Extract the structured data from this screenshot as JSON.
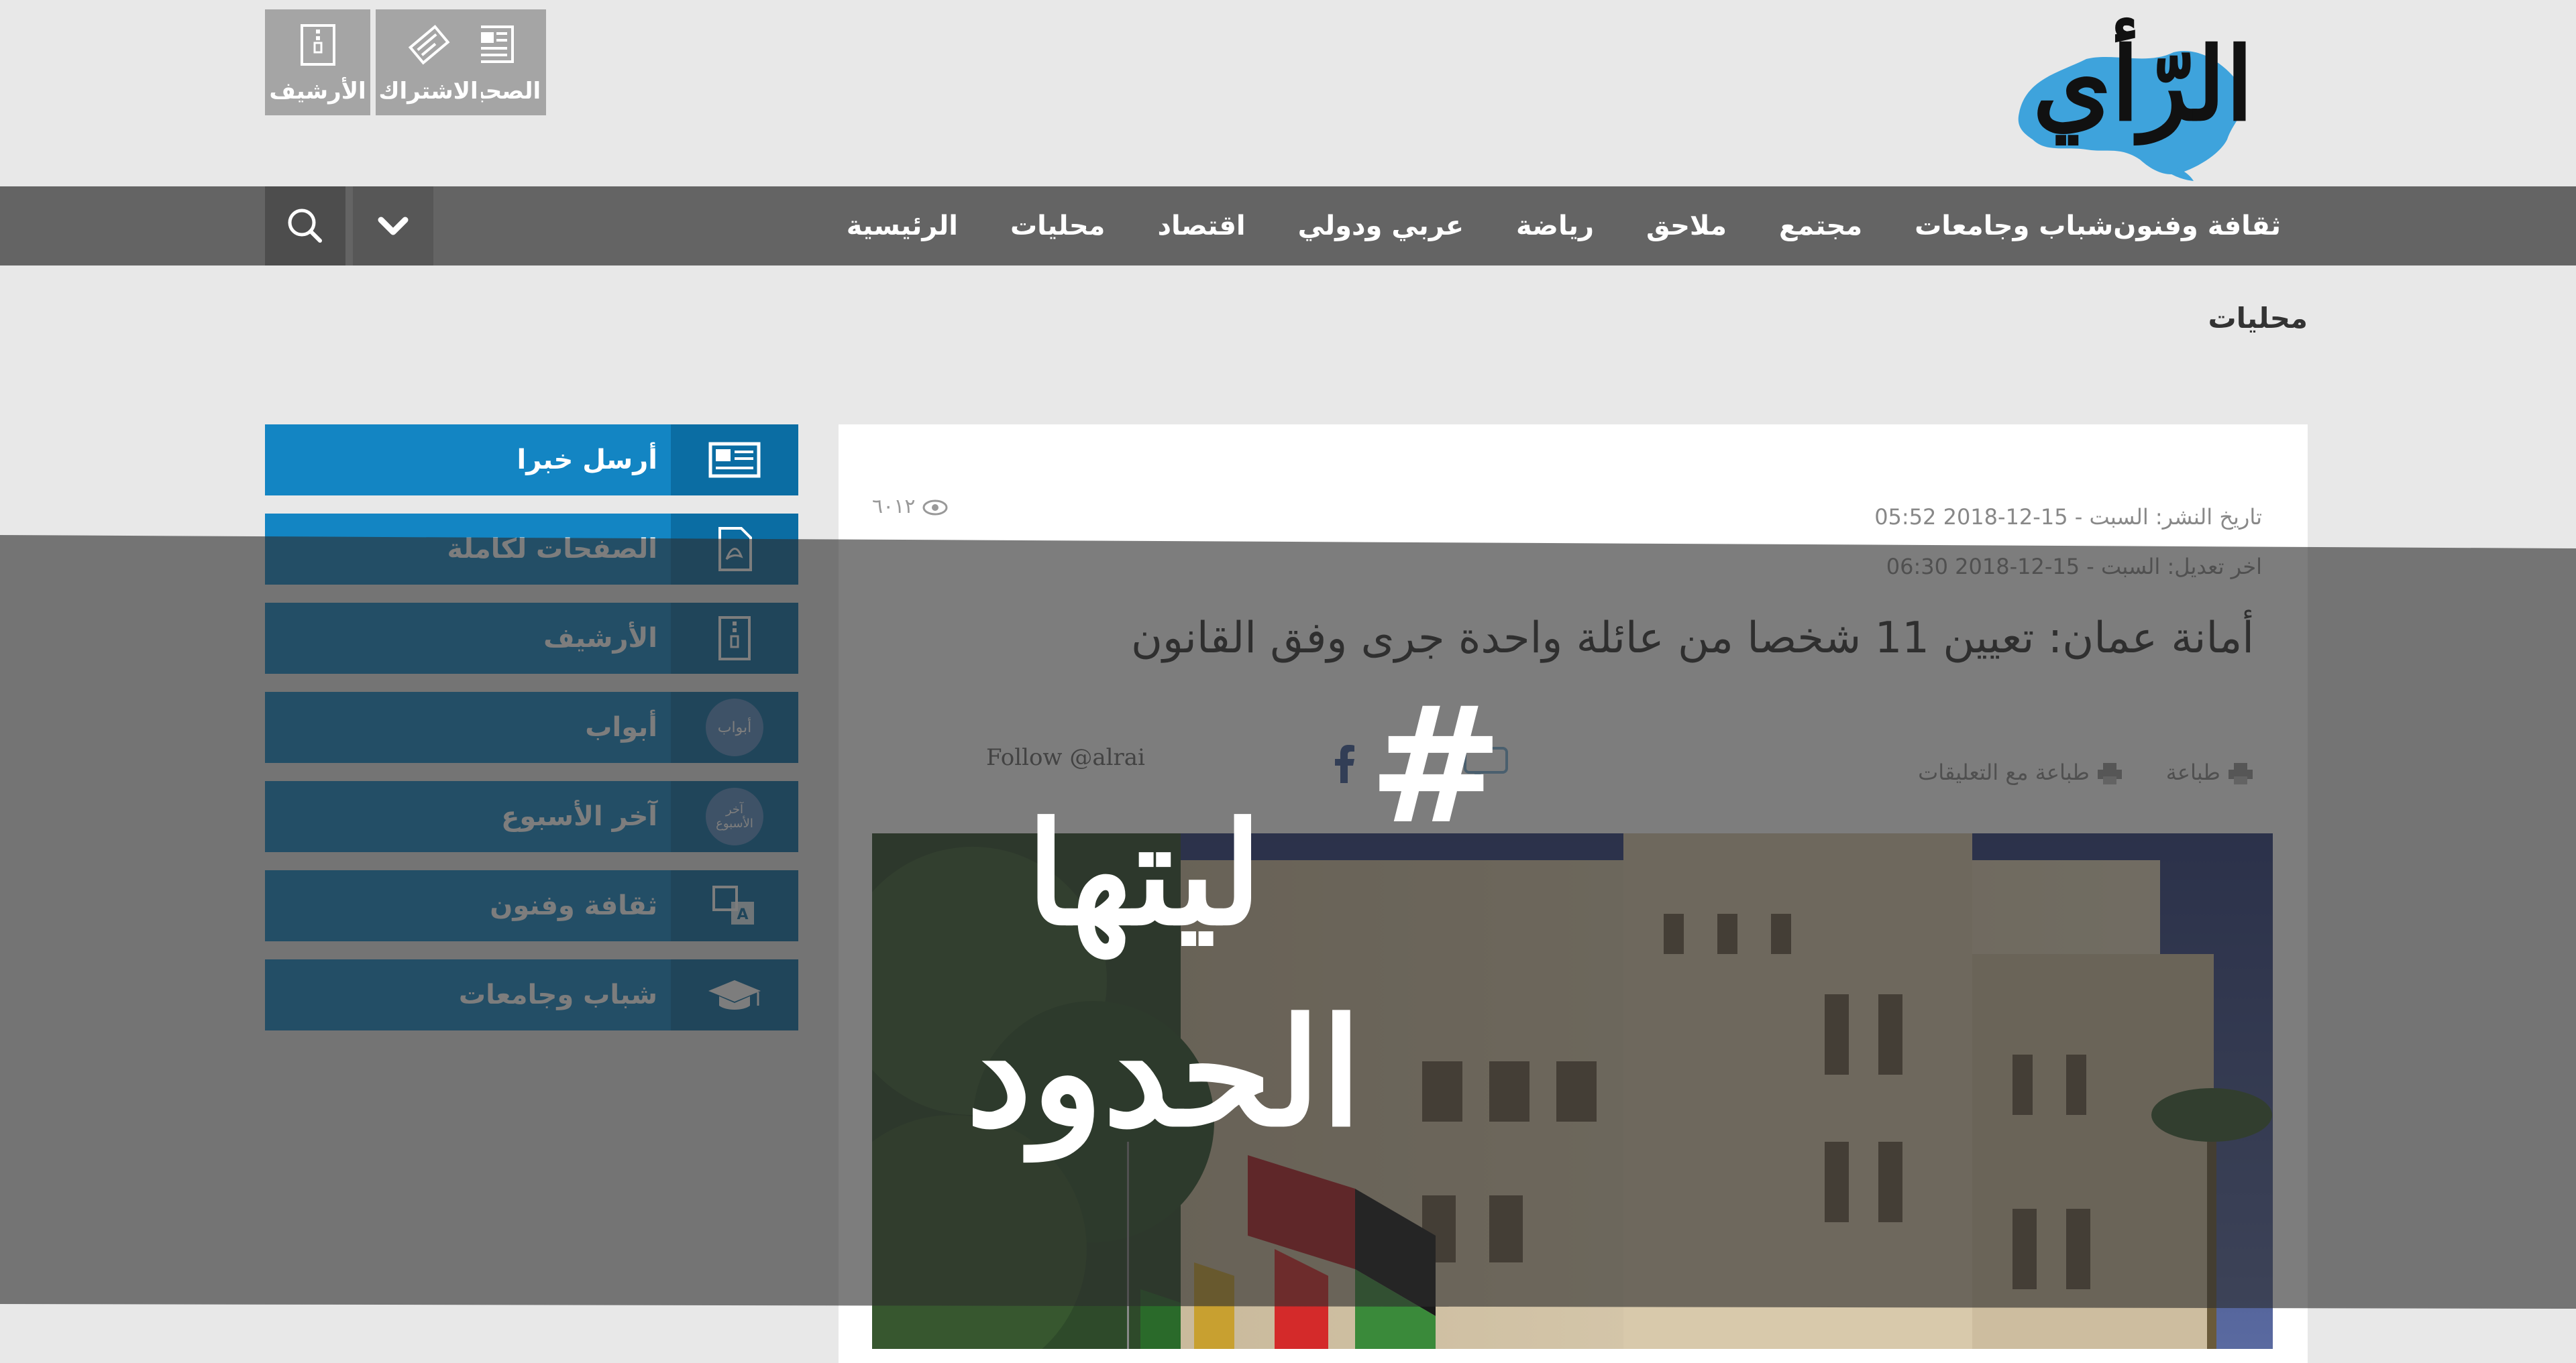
{
  "header": {
    "logo_text": "الرّأي",
    "tools": [
      {
        "label": "الصحيفة",
        "icon": "newspaper-icon"
      },
      {
        "label": "الاشتراك",
        "icon": "subscription-icon"
      },
      {
        "label": "الأرشيف",
        "icon": "archive-icon"
      }
    ]
  },
  "nav": {
    "items": [
      "الرئيسية",
      "محليات",
      "اقتصاد",
      "عربي ودولي",
      "رياضة",
      "ملاحق",
      "مجتمع",
      "شباب وجامعات",
      "ثقافة وفنون"
    ],
    "search_icon": "search-icon",
    "more_icon": "chevron-down-icon"
  },
  "section_title": "محليات",
  "sidebar": {
    "items": [
      {
        "label": "أرسل خبرا",
        "icon": "news-icon"
      },
      {
        "label": "الصفحات لكاملة",
        "icon": "pdf-icon"
      },
      {
        "label": "الأرشيف",
        "icon": "archive-icon"
      },
      {
        "label": "أبواب",
        "icon": "abwab-icon",
        "badge": "أبواب"
      },
      {
        "label": "آخر الأسبوع",
        "icon": "week-icon",
        "badge": "آخر الأسبوع"
      },
      {
        "label": "ثقافة وفنون",
        "icon": "translate-icon"
      },
      {
        "label": "شباب وجامعات",
        "icon": "graduation-cap-icon"
      }
    ]
  },
  "article": {
    "published": "تاريخ النشر: السبت - 15-12-2018 05:52",
    "updated": "اخر تعديل: السبت - 15-12-2018 06:30",
    "views": "٦٠١٢",
    "headline": "أمانة عمان: تعيين 11 شخصا من عائلة واحدة جرى وفق القانون",
    "print_label": "طباعة",
    "print_apps_label": "طباعة مع التعليقات",
    "follow_label": "Follow @alrai"
  },
  "overlay": {
    "hashtag": "#",
    "line1": "ليتها",
    "line2": "الحدود"
  },
  "colors": {
    "nav_bg": "#646464",
    "sidebar_blue": "#1385c3",
    "sidebar_icon_blue": "#0b6da3",
    "overlay_band": "rgba(50,50,50,0.62)",
    "tool_gray": "#a5a5a5"
  }
}
